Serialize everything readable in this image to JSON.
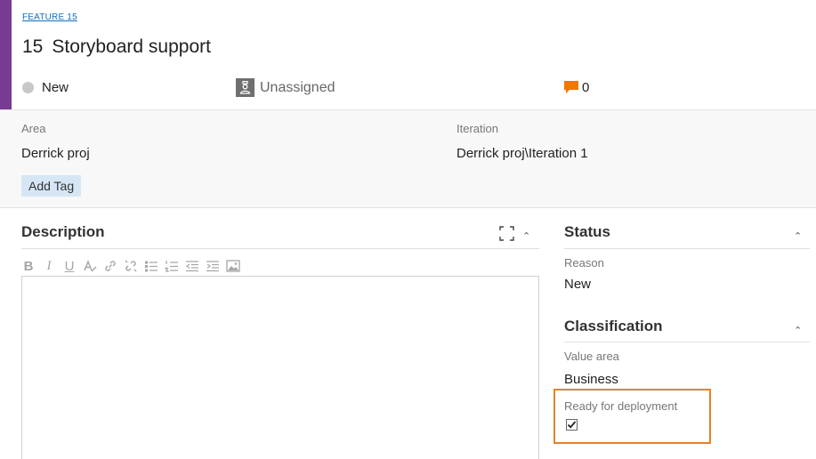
{
  "work_item": {
    "type_link": "FEATURE 15",
    "id": "15",
    "title": "Storyboard support",
    "state": "New",
    "assignee": "Unassigned",
    "comment_count": "0"
  },
  "fields": {
    "area_label": "Area",
    "area_value": "Derrick proj",
    "iteration_label": "Iteration",
    "iteration_value": "Derrick proj\\Iteration 1",
    "add_tag_label": "Add Tag"
  },
  "description": {
    "heading": "Description",
    "toolbar": [
      "bold",
      "italic",
      "underline",
      "highlight",
      "link",
      "unlink",
      "bulleted-list",
      "numbered-list",
      "decrease-indent",
      "increase-indent",
      "insert-image"
    ],
    "toolbar_glyphs": [
      "B",
      "I",
      "U"
    ],
    "content": ""
  },
  "status": {
    "heading": "Status",
    "reason_label": "Reason",
    "reason_value": "New"
  },
  "classification": {
    "heading": "Classification",
    "value_area_label": "Value area",
    "value_area_value": "Business",
    "ready_label": "Ready for deployment",
    "ready_checked": true
  },
  "colors": {
    "accent": "#773b93",
    "link": "#106ebe",
    "comment": "#f07800",
    "highlight_border": "#e3822a",
    "tag_bg": "#d6e6f5"
  },
  "icons": {
    "collapse": "chevron-up-icon",
    "expand": "fullscreen-icon",
    "assignee": "user-badge-icon",
    "comments": "speech-bubble-icon"
  }
}
